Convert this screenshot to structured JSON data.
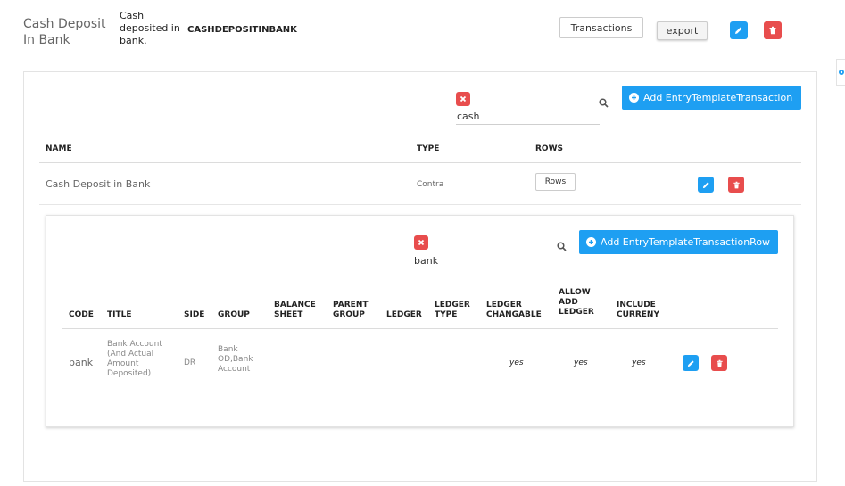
{
  "header": {
    "title": "Cash Deposit In Bank",
    "description": "Cash deposited in bank.",
    "code": "CASHDEPOSITINBANK",
    "transactions_button": "Transactions",
    "export_button": "export"
  },
  "transactions_panel": {
    "search": {
      "value": "cash"
    },
    "add_button": "Add EntryTemplateTransaction",
    "columns": {
      "name": "NAME",
      "type": "TYPE",
      "rows": "ROWS"
    },
    "rows": [
      {
        "name": "Cash Deposit in Bank",
        "type": "Contra",
        "rows_button": "Rows"
      }
    ]
  },
  "rows_panel": {
    "search": {
      "value": "bank"
    },
    "add_button": "Add EntryTemplateTransactionRow",
    "columns": {
      "code": "CODE",
      "title": "TITLE",
      "side": "SIDE",
      "group": "GROUP",
      "balance_sheet_1": "BALANCE",
      "balance_sheet_2": "SHEET",
      "parent_group_1": "PARENT",
      "parent_group_2": "GROUP",
      "ledger": "LEDGER",
      "ledger_type_1": "LEDGER",
      "ledger_type_2": "TYPE",
      "ledger_changable_1": "LEDGER",
      "ledger_changable_2": "CHANGABLE",
      "allow_add_ledger_1": "ALLOW",
      "allow_add_ledger_2": "ADD",
      "allow_add_ledger_3": "LEDGER",
      "include_currency_1": "INCLUDE",
      "include_currency_2": "CURRENY"
    },
    "rows": [
      {
        "code": "bank",
        "title_1": "Bank Account",
        "title_2": "(And Actual",
        "title_3": "Amount",
        "title_4": "Deposited)",
        "side": "DR",
        "group_1": "Bank",
        "group_2": "OD,Bank",
        "group_3": "Account",
        "ledger_changable": "yes",
        "allow_add_ledger": "yes",
        "include_currency": "yes"
      }
    ]
  },
  "colors": {
    "accent": "#1e9ff2",
    "danger": "#e84d4d"
  }
}
